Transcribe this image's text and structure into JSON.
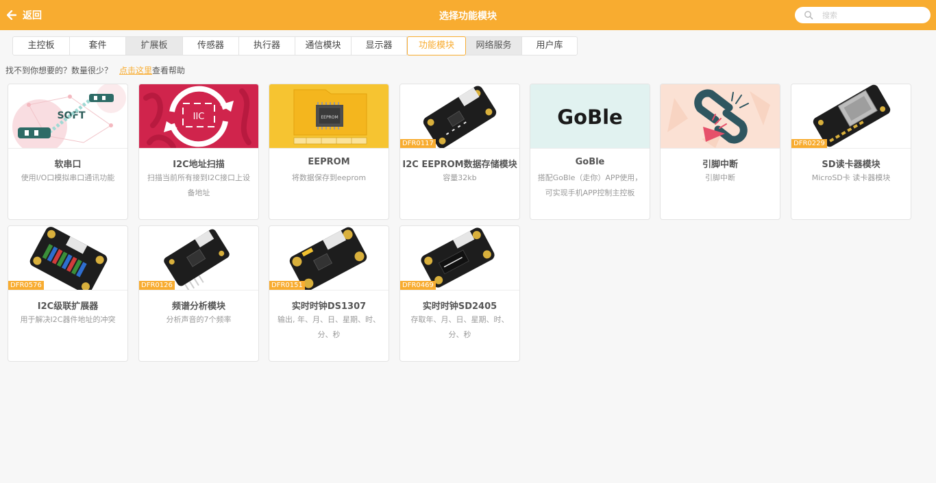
{
  "header": {
    "back_label": "返回",
    "title": "选择功能模块",
    "search_placeholder": "搜索"
  },
  "tabs": [
    {
      "label": "主控板",
      "state": "normal"
    },
    {
      "label": "套件",
      "state": "normal"
    },
    {
      "label": "扩展板",
      "state": "gray"
    },
    {
      "label": "传感器",
      "state": "normal"
    },
    {
      "label": "执行器",
      "state": "normal"
    },
    {
      "label": "通信模块",
      "state": "normal"
    },
    {
      "label": "显示器",
      "state": "normal"
    },
    {
      "label": "功能模块",
      "state": "active"
    },
    {
      "label": "网络服务",
      "state": "gray"
    },
    {
      "label": "用户库",
      "state": "normal"
    }
  ],
  "hint": {
    "text": "找不到你想要的？数量很少？",
    "link": "点击这里",
    "suffix": "查看帮助"
  },
  "cards": [
    {
      "name": "软串口",
      "desc": "使用I/O口模拟串口通讯功能",
      "sku": "",
      "thumb_text": "SOFT"
    },
    {
      "name": "I2C地址扫描",
      "desc": "扫描当前所有接到I2C接口上设备地址",
      "sku": "",
      "thumb_text": "IIC"
    },
    {
      "name": "EEPROM",
      "desc": "将数据保存到eeprom",
      "sku": "",
      "thumb_text": "EEPROM"
    },
    {
      "name": "I2C EEPROM数据存储模块",
      "desc": "容量32kb",
      "sku": "DFR0117",
      "thumb_text": ""
    },
    {
      "name": "GoBle",
      "desc": "搭配GoBle（走你）APP使用，可实现手机APP控制主控板",
      "sku": "",
      "thumb_text": "GoBle"
    },
    {
      "name": "引脚中断",
      "desc": "引脚中断",
      "sku": "",
      "thumb_text": ""
    },
    {
      "name": "SD读卡器模块",
      "desc": "MicroSD卡 读卡器模块",
      "sku": "DFR0229",
      "thumb_text": ""
    },
    {
      "name": "I2C级联扩展器",
      "desc": "用于解决I2C器件地址的冲突",
      "sku": "DFR0576",
      "thumb_text": ""
    },
    {
      "name": "频谱分析模块",
      "desc": "分析声音的7个频率",
      "sku": "DFR0126",
      "thumb_text": ""
    },
    {
      "name": "实时时钟DS1307",
      "desc": "输出, 年、月、日、星期、时、分、秒",
      "sku": "DFR0151",
      "thumb_text": ""
    },
    {
      "name": "实时时钟SD2405",
      "desc": "存取年、月、日、星期、时、分、秒",
      "sku": "DFR0469",
      "thumb_text": ""
    }
  ]
}
